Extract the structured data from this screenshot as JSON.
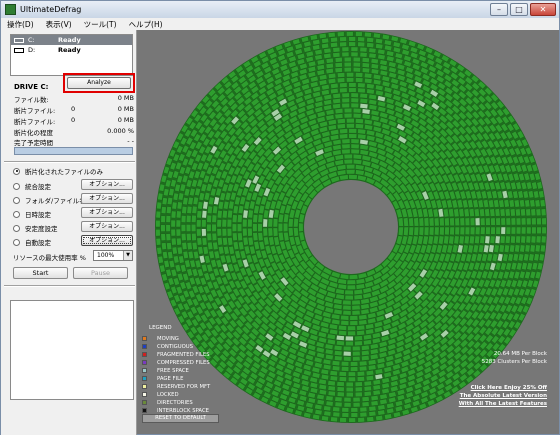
{
  "window": {
    "title": "UltimateDefrag",
    "buttons": [
      "–",
      "□",
      "✕"
    ]
  },
  "menu": [
    "操作(D)",
    "表示(V)",
    "ツール(T)",
    "ヘルプ(H)"
  ],
  "drives": [
    {
      "name": "C:",
      "status": "Ready",
      "selected": true
    },
    {
      "name": "D:",
      "status": "Ready",
      "selected": false
    }
  ],
  "drive_panel": {
    "title": "DRIVE C:",
    "analyze_label": "Analyze",
    "stats": [
      {
        "label": "ファイル数:",
        "value": "",
        "unit": "0 MB"
      },
      {
        "label": "断片ファイル:",
        "value": "0",
        "unit": "0 MB"
      },
      {
        "label": "断片ファイル:",
        "value": "0",
        "unit": "0 MB"
      },
      {
        "label": "断片化の程度",
        "value": "",
        "unit": "0.000 %"
      },
      {
        "label": "完了予定時間",
        "value": "",
        "unit": "- -"
      }
    ]
  },
  "options": {
    "radios": [
      {
        "label": "断片化されたファイルのみ",
        "checked": true,
        "button": ""
      },
      {
        "label": "統合設定",
        "checked": false,
        "button": "オプション..."
      },
      {
        "label": "フォルダ/ファイル名",
        "checked": false,
        "button": "オプション..."
      },
      {
        "label": "日時設定",
        "checked": false,
        "button": "オプション..."
      },
      {
        "label": "安定度設定",
        "checked": false,
        "button": "オプション..."
      },
      {
        "label": "自動設定",
        "checked": false,
        "button": "オプション..."
      }
    ],
    "usage_label": "リソースの最大使用率 %",
    "usage_value": "100%",
    "start_label": "Start",
    "pause_label": "Pause"
  },
  "legend": {
    "title": "LEGEND",
    "items": [
      {
        "label": "MOVING",
        "color": "#e07a1f"
      },
      {
        "label": "CONTIGUOUS",
        "color": "#1f3fbf"
      },
      {
        "label": "FRAGMENTED FILES",
        "color": "#d02020"
      },
      {
        "label": "COMPRESSED FILES",
        "color": "#7a3ac0"
      },
      {
        "label": "FREE SPACE",
        "color": "#9cc8c8"
      },
      {
        "label": "PAGE FILE",
        "color": "#20a0c0"
      },
      {
        "label": "RESERVED FOR MFT",
        "color": "#f0f0a0"
      },
      {
        "label": "LOCKED",
        "color": "#f8f8e8"
      },
      {
        "label": "DIRECTORIES",
        "color": "#6a8a3a"
      },
      {
        "label": "INTERBLOCK SPACE",
        "color": "#101010"
      }
    ],
    "reset_label": "RESET TO DEFAULT"
  },
  "map_info": {
    "per_block": "20.64 MB Per Block",
    "clusters": "5283 Clusters Per Block",
    "promo": [
      "Click Here Enjoy 25% Off",
      "The Absolute Latest Version",
      "With All The Latest Features"
    ]
  },
  "colors": {
    "block": "#2e9e2e",
    "block_free": "#a8d0a8",
    "map_bg": "#777777",
    "highlight": "#e00000"
  }
}
